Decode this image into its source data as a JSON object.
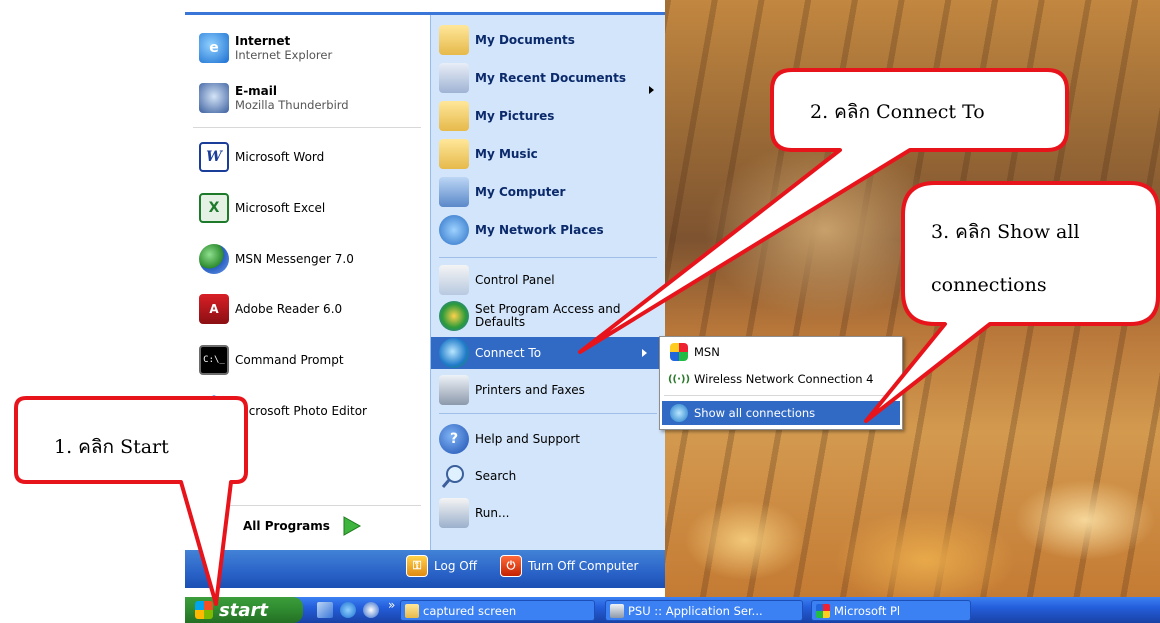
{
  "start_menu": {
    "left_pinned": [
      {
        "title": "Internet",
        "subtitle": "Internet Explorer",
        "icon": "internet-explorer-icon"
      },
      {
        "title": "E-mail",
        "subtitle": "Mozilla Thunderbird",
        "icon": "thunderbird-icon"
      }
    ],
    "left_recent": [
      {
        "label": "Microsoft Word",
        "icon": "word-icon"
      },
      {
        "label": "Microsoft Excel",
        "icon": "excel-icon"
      },
      {
        "label": "MSN Messenger 7.0",
        "icon": "msn-messenger-icon"
      },
      {
        "label": "Adobe Reader 6.0",
        "icon": "adobe-reader-icon"
      },
      {
        "label": "Command Prompt",
        "icon": "command-prompt-icon"
      },
      {
        "label": "Microsoft Photo Editor",
        "icon": "photo-editor-icon"
      }
    ],
    "all_programs": "All Programs",
    "right_items": [
      {
        "label": "My Documents",
        "icon": "folder-documents-icon"
      },
      {
        "label": "My Recent Documents",
        "icon": "recent-documents-icon"
      },
      {
        "label": "My Pictures",
        "icon": "folder-pictures-icon"
      },
      {
        "label": "My Music",
        "icon": "folder-music-icon"
      },
      {
        "label": "My Computer",
        "icon": "computer-icon"
      },
      {
        "label": "My Network Places",
        "icon": "network-places-icon"
      }
    ],
    "right_system": [
      {
        "label": "Control Panel",
        "icon": "control-panel-icon"
      },
      {
        "label": "Set Program Access and Defaults",
        "icon": "program-access-icon"
      },
      {
        "label": "Connect To",
        "icon": "connect-to-icon"
      },
      {
        "label": "Printers and Faxes",
        "icon": "printer-icon"
      },
      {
        "label": "Help and Support",
        "icon": "help-icon"
      },
      {
        "label": "Search",
        "icon": "search-icon"
      },
      {
        "label": "Run...",
        "icon": "run-icon"
      }
    ],
    "log_off": "Log Off",
    "turn_off": "Turn Off Computer"
  },
  "connect_submenu": {
    "items": [
      {
        "label": "MSN",
        "icon": "msn-butterfly-icon"
      },
      {
        "label": "Wireless Network Connection 4",
        "icon": "wireless-icon"
      },
      {
        "label": "Show all connections",
        "icon": "network-connections-icon"
      }
    ]
  },
  "taskbar": {
    "start_label": "start",
    "quick_launch_icons": [
      "desktop-icon",
      "internet-explorer-icon",
      "media-player-icon"
    ],
    "chevron": "»",
    "buttons": [
      {
        "label": "captured screen"
      },
      {
        "label": "PSU :: Application Ser..."
      },
      {
        "label": "Microsoft Pl"
      }
    ]
  },
  "callouts": {
    "step1": "1. คลิก Start",
    "step2": "2. คลิก Connect To",
    "step3_line1": "3. คลิก Show all",
    "step3_line2": "connections"
  },
  "colors": {
    "callout_border": "#e8141b",
    "highlight": "#316ac5",
    "taskbar": "#245edb",
    "start_button": "#2f8a2f"
  }
}
